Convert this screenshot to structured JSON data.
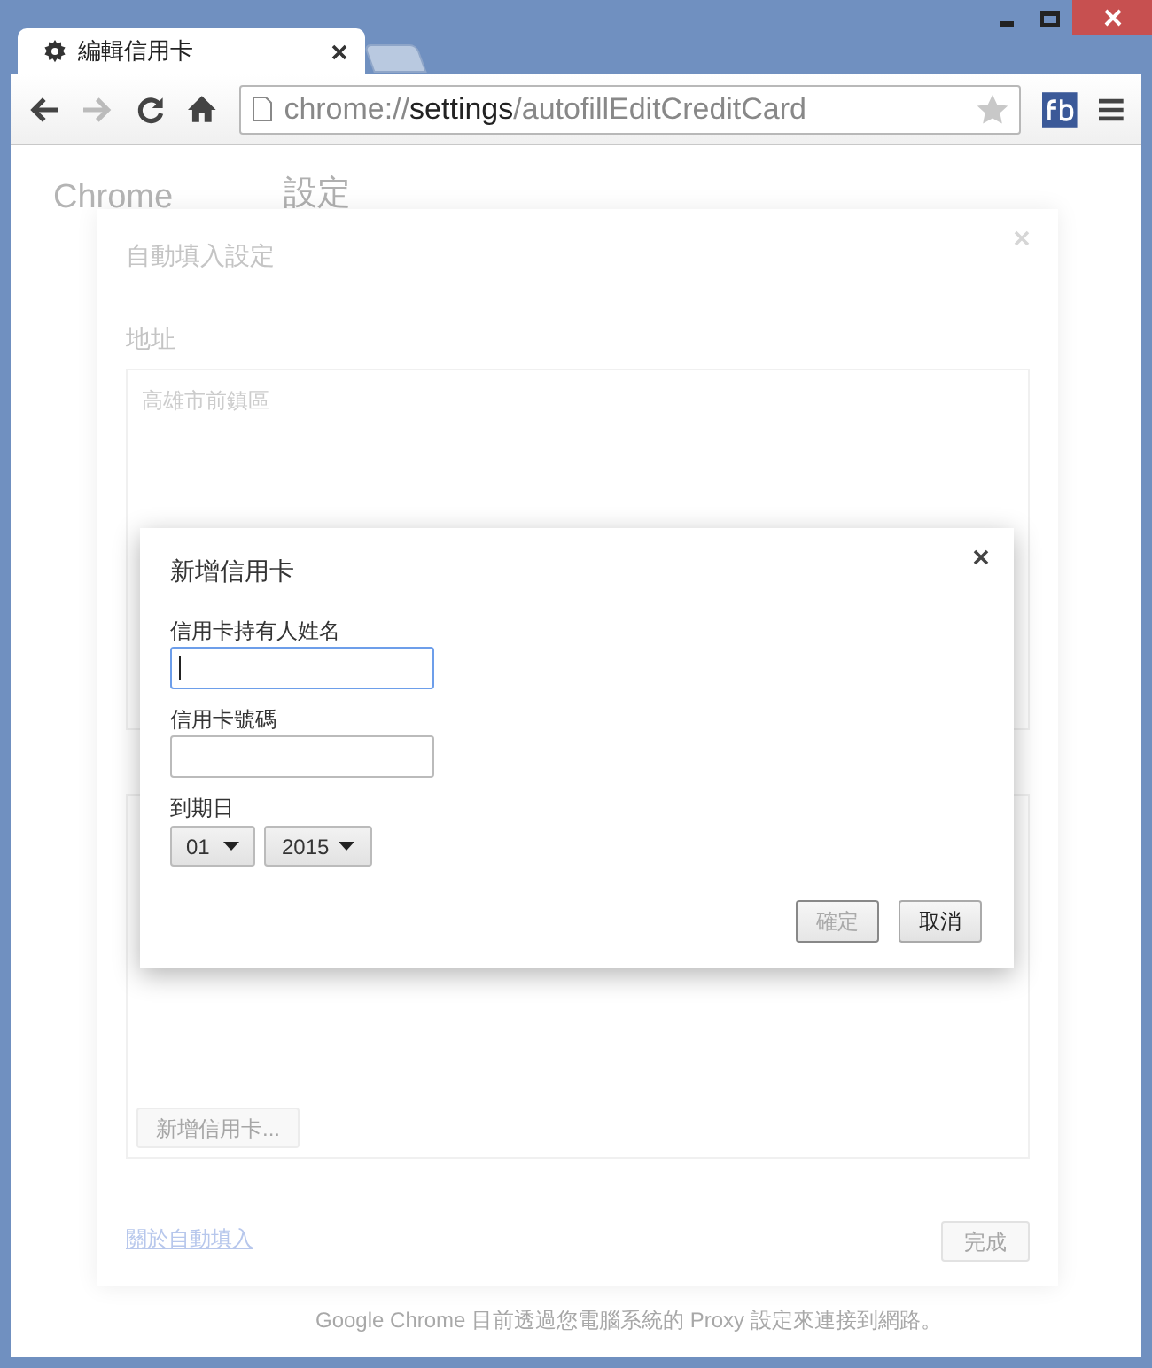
{
  "window": {
    "tab": {
      "title": "編輯信用卡"
    },
    "address": {
      "scheme": "chrome://",
      "host": "settings",
      "path": "/autofillEditCreditCard"
    }
  },
  "background_page": {
    "brand": "Chrome",
    "heading": "設定",
    "footer_note": "Google Chrome 目前透過您電腦系統的 Proxy 設定來連接到網路。"
  },
  "autofill_settings": {
    "title": "自動填入設定",
    "address_label": "地址",
    "addresses": [
      "高雄市前鎮區"
    ],
    "add_card_button": "新增信用卡...",
    "about_link": "關於自動填入",
    "done_button": "完成"
  },
  "dialog": {
    "title": "新增信用卡",
    "fields": [
      {
        "label": "信用卡持有人姓名",
        "focused": true
      },
      {
        "label": "信用卡號碼",
        "focused": false
      }
    ],
    "expiry_label": "到期日",
    "month": "01",
    "year": "2015",
    "buttons": [
      {
        "label": "確定",
        "disabled": true
      },
      {
        "label": "取消",
        "disabled": false
      }
    ]
  }
}
